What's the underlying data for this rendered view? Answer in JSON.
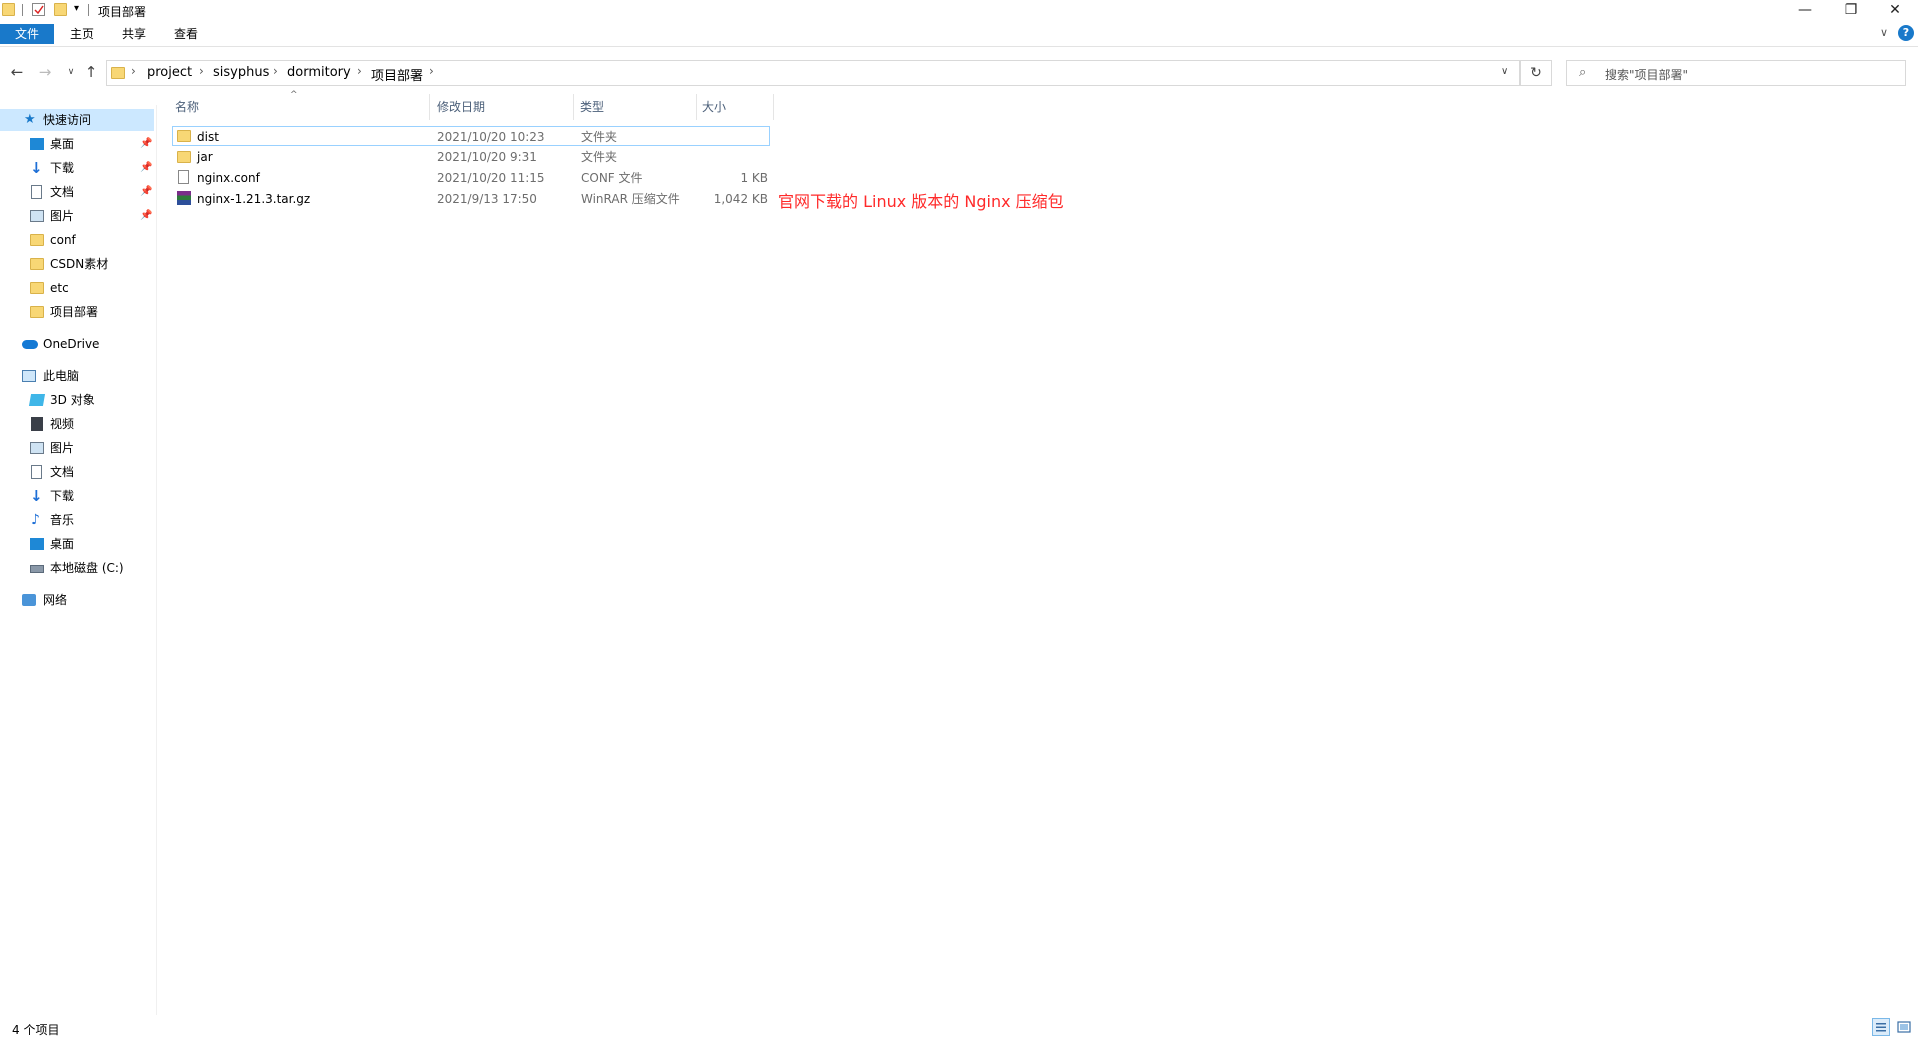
{
  "window": {
    "title": "项目部署",
    "buttons": {
      "minimize": "—",
      "restore": "❐",
      "close": "✕"
    }
  },
  "ribbon": {
    "tabs": [
      {
        "label": "文件",
        "active": true
      },
      {
        "label": "主页"
      },
      {
        "label": "共享"
      },
      {
        "label": "查看"
      }
    ],
    "help_icon": "question-icon"
  },
  "address": {
    "crumbs": [
      "project",
      "sisyphus",
      "dormitory",
      "项目部署"
    ],
    "search_placeholder": "搜索\"项目部署\""
  },
  "sidebar": {
    "quick_access": {
      "label": "快速访问",
      "items": [
        {
          "label": "桌面",
          "icon": "desktop-icon",
          "pinned": true
        },
        {
          "label": "下载",
          "icon": "download-icon",
          "pinned": true
        },
        {
          "label": "文档",
          "icon": "document-icon",
          "pinned": true
        },
        {
          "label": "图片",
          "icon": "picture-icon",
          "pinned": true
        },
        {
          "label": "conf",
          "icon": "folder-icon"
        },
        {
          "label": "CSDN素材",
          "icon": "folder-icon"
        },
        {
          "label": "etc",
          "icon": "folder-icon"
        },
        {
          "label": "项目部署",
          "icon": "folder-icon"
        }
      ]
    },
    "onedrive": {
      "label": "OneDrive"
    },
    "this_pc": {
      "label": "此电脑",
      "items": [
        {
          "label": "3D 对象",
          "icon": "cube-icon"
        },
        {
          "label": "视频",
          "icon": "video-icon"
        },
        {
          "label": "图片",
          "icon": "picture-icon"
        },
        {
          "label": "文档",
          "icon": "document-icon"
        },
        {
          "label": "下载",
          "icon": "download-icon"
        },
        {
          "label": "音乐",
          "icon": "music-icon"
        },
        {
          "label": "桌面",
          "icon": "desktop-icon"
        },
        {
          "label": "本地磁盘 (C:)",
          "icon": "disk-icon"
        }
      ]
    },
    "network": {
      "label": "网络"
    }
  },
  "columns": {
    "name": "名称",
    "modified": "修改日期",
    "type": "类型",
    "size": "大小"
  },
  "files": [
    {
      "name": "dist",
      "modified": "2021/10/20 10:23",
      "type": "文件夹",
      "size": "",
      "icon": "folder-icon",
      "selected": true
    },
    {
      "name": "jar",
      "modified": "2021/10/20 9:31",
      "type": "文件夹",
      "size": "",
      "icon": "folder-icon"
    },
    {
      "name": "nginx.conf",
      "modified": "2021/10/20 11:15",
      "type": "CONF 文件",
      "size": "1 KB",
      "icon": "file-icon"
    },
    {
      "name": "nginx-1.21.3.tar.gz",
      "modified": "2021/9/13 17:50",
      "type": "WinRAR 压缩文件",
      "size": "1,042 KB",
      "icon": "archive-icon"
    }
  ],
  "annotation": "官网下载的 Linux 版本的 Nginx 压缩包",
  "status": {
    "item_count": "4 个项目"
  },
  "colors": {
    "accent": "#1979ca",
    "selection": "#cce8ff",
    "annotation": "#ff2a2a",
    "folder": "#f8d775"
  }
}
